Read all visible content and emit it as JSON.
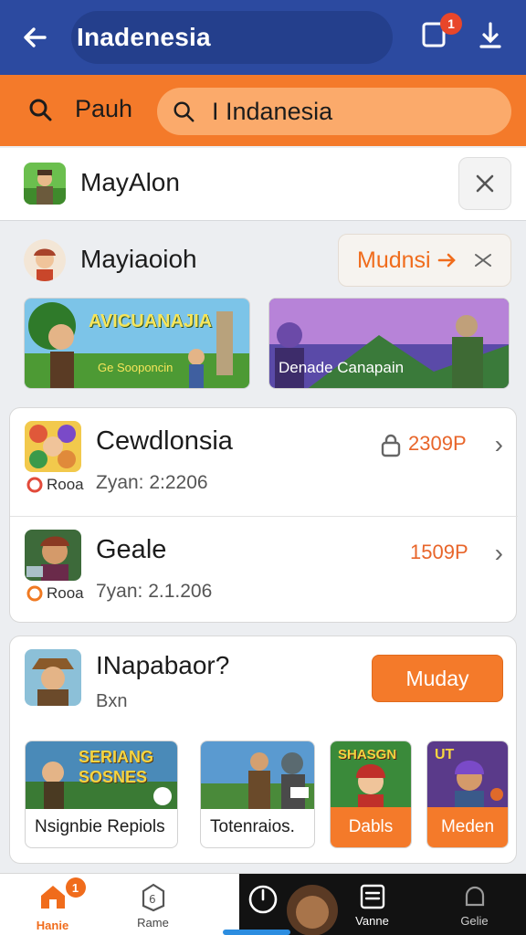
{
  "header": {
    "title": "Inadenesia",
    "notification_count": "1"
  },
  "search": {
    "left_label": "Pauh",
    "query": "I Indanesia"
  },
  "row1": {
    "title": "MayAlon"
  },
  "section2": {
    "title": "Mayiaoioh",
    "button_label": "Mudnsi",
    "banners": [
      {
        "label": "AVICUANAJIA",
        "sublabel": "Ge Sooponcin"
      },
      {
        "label": "Denade Canapain"
      }
    ]
  },
  "list": [
    {
      "title": "Cewdlonsia",
      "tag": "Rooa",
      "subtitle": "Zyan: 2:2206",
      "price": "2309P"
    },
    {
      "title": "Geale",
      "tag": "Rooa",
      "subtitle": "7yan: 2.1.206",
      "price": "1509P"
    }
  ],
  "promo": {
    "title": "INapabaor?",
    "subtitle": "Bxn",
    "button_label": "Muday",
    "tiles": [
      {
        "art_text": "SERIANG SOSNES",
        "label": "Nsignbie Repiols",
        "style": "plain"
      },
      {
        "art_text": "",
        "label": "Totenraios.",
        "style": "plain"
      },
      {
        "art_text": "SHASGN",
        "label": "Dabls",
        "style": "orange"
      },
      {
        "art_text": "UT",
        "label": "Meden",
        "style": "orange"
      }
    ]
  },
  "bottom_nav": [
    {
      "label": "Hanie",
      "icon": "home-icon",
      "badge": "1",
      "active": true
    },
    {
      "label": "Rame",
      "icon": "tag-icon"
    },
    {
      "label": "",
      "icon": "power-icon"
    },
    {
      "label": "Vanne",
      "icon": "list-icon"
    },
    {
      "label": "Gelie",
      "icon": "bell-icon"
    }
  ],
  "colors": {
    "header_blue": "#2c4aa0",
    "accent_orange": "#f47a2a",
    "background": "#eceef1"
  }
}
